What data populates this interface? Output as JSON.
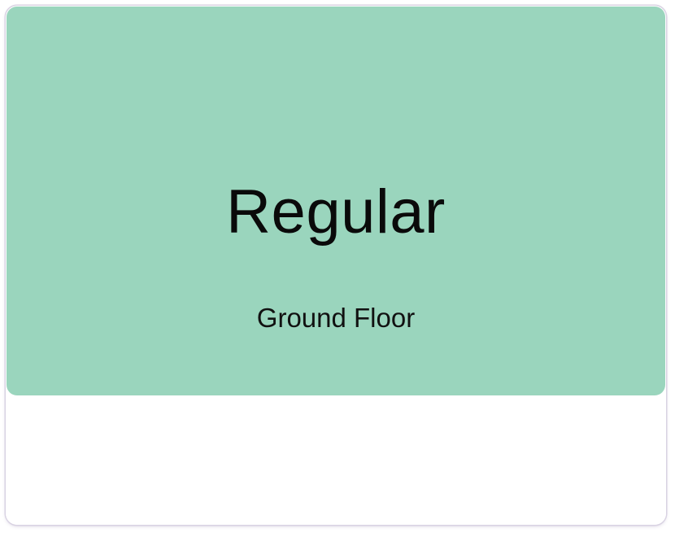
{
  "card": {
    "title": "Regular",
    "subtitle": "Ground Floor",
    "header_color": "#9ad5bd"
  }
}
